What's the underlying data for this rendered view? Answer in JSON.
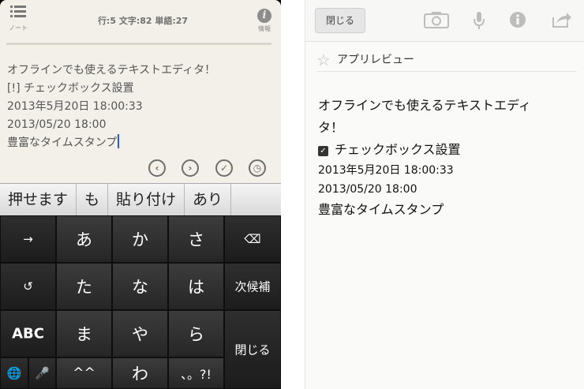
{
  "left_screen": {
    "toolbar": {
      "note_label": "ノート",
      "info_label": "情報",
      "counts": "行:5 文字:82 単語:27"
    },
    "editor_lines": [
      "オフラインでも使えるテキストエディタ！",
      "[!] チェックボックス設置",
      "2013年5月20日 18:00:33",
      "2013/05/20 18:00",
      "豊富なタイムスタンプ"
    ],
    "round_buttons": {
      "prev": "‹",
      "next": "›",
      "check": "✓",
      "clock": "◷"
    },
    "suggestions": [
      "押せます",
      "も",
      "貼り付け",
      "あり"
    ],
    "keyboard": {
      "row1": [
        "→",
        "あ",
        "か",
        "さ",
        "⌫"
      ],
      "row2": [
        "↺",
        "た",
        "な",
        "は",
        "次候補"
      ],
      "row3": [
        "ABC",
        "ま",
        "や",
        "ら",
        "閉じる"
      ],
      "row4": [
        "🌐",
        "🎤",
        "^^",
        "わ",
        "、。?!"
      ]
    }
  },
  "right_screen": {
    "close_label": "閉じる",
    "review_label": "アプリレビュー",
    "content": {
      "line1": "オフラインでも使えるテキストエディ",
      "line2": "タ！",
      "checkbox_label": "チェックボックス設置",
      "date1": "2013年5月20日 18:00:33",
      "date2": "2013/05/20 18:00",
      "timestamp": "豊富なタイムスタンプ"
    }
  },
  "icons": {
    "list": "list-icon",
    "info": "info-icon",
    "camera": "camera-icon",
    "mic": "microphone-icon",
    "share": "share-icon",
    "star": "star-icon"
  }
}
